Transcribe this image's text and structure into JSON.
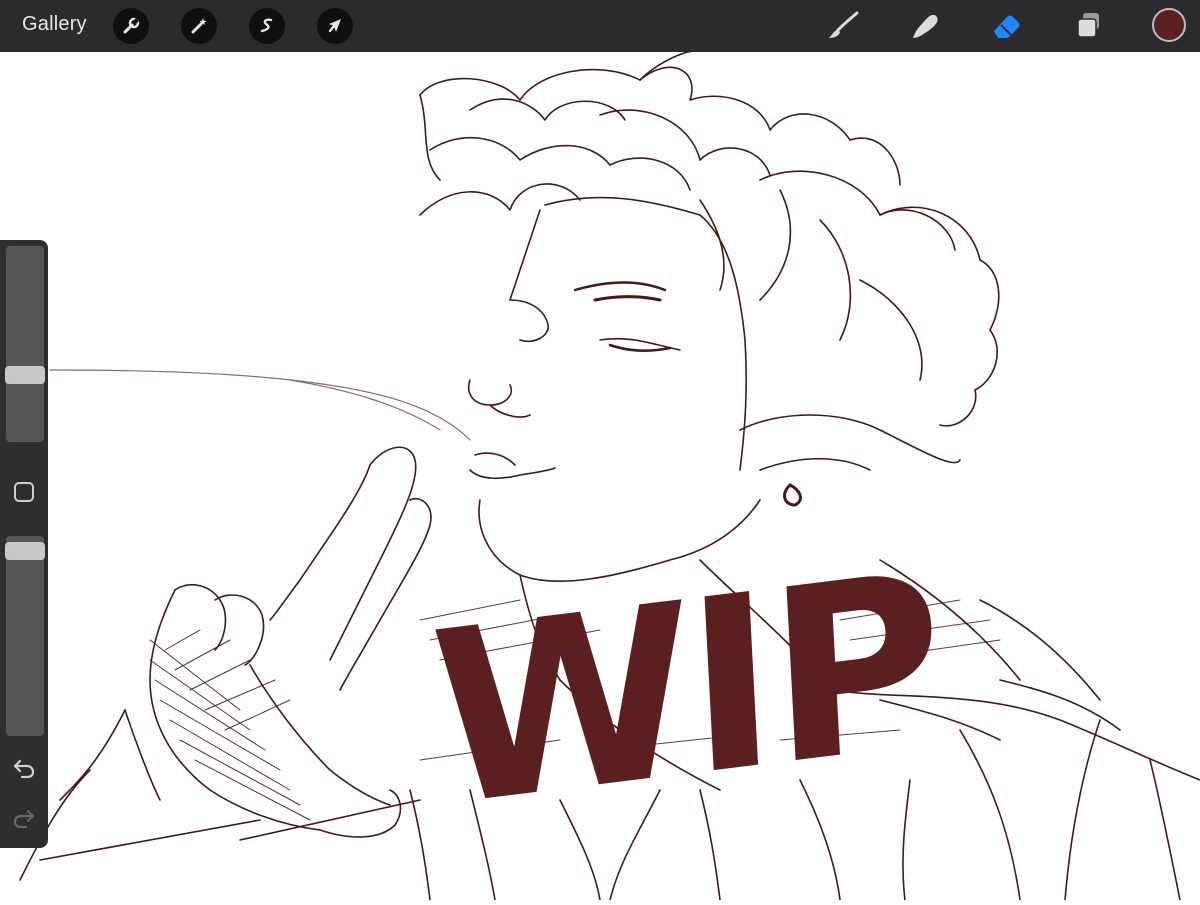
{
  "toolbar": {
    "gallery_label": "Gallery",
    "left_tools": [
      {
        "name": "actions",
        "icon": "wrench-icon"
      },
      {
        "name": "adjustments",
        "icon": "magic-wand-icon"
      },
      {
        "name": "selection",
        "icon": "selection-s-icon"
      },
      {
        "name": "transform",
        "icon": "arrow-cursor-icon"
      }
    ],
    "right_tools": [
      {
        "name": "brush",
        "icon": "brush-icon"
      },
      {
        "name": "smudge",
        "icon": "smudge-finger-icon"
      },
      {
        "name": "eraser",
        "icon": "eraser-icon",
        "active": true
      },
      {
        "name": "layers",
        "icon": "layers-icon"
      }
    ],
    "active_tool_color": "#1e88ff",
    "current_color": "#5b1f1f"
  },
  "sidebar": {
    "brush_size_level": 0.35,
    "opacity_level": 0.98,
    "modify_icon": "square-modify-icon",
    "undo_icon": "undo-icon",
    "redo_icon": "redo-icon"
  },
  "canvas": {
    "overlay_text": "WIP",
    "ink_color": "#5b1f1f",
    "sketch_color": "#4a1515"
  }
}
